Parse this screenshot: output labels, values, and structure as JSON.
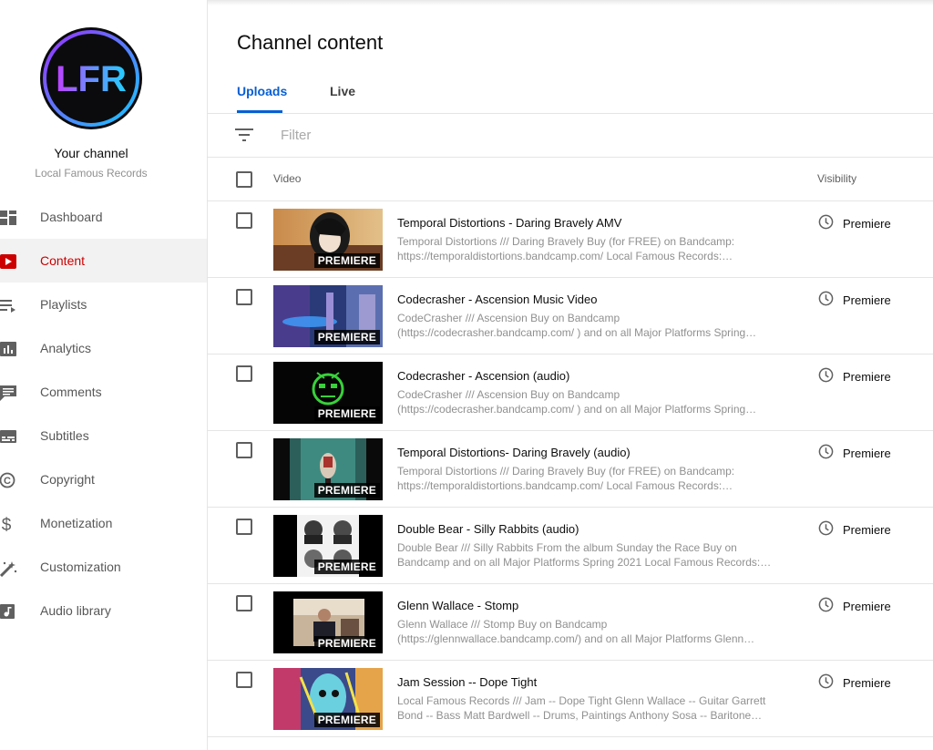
{
  "channel": {
    "logo_text": "LFR",
    "title": "Your channel",
    "name": "Local Famous Records"
  },
  "nav": {
    "items": [
      {
        "label": "Dashboard",
        "icon": "dashboard-icon",
        "active": false
      },
      {
        "label": "Content",
        "icon": "content-icon",
        "active": true
      },
      {
        "label": "Playlists",
        "icon": "playlists-icon",
        "active": false
      },
      {
        "label": "Analytics",
        "icon": "analytics-icon",
        "active": false
      },
      {
        "label": "Comments",
        "icon": "comments-icon",
        "active": false
      },
      {
        "label": "Subtitles",
        "icon": "subtitles-icon",
        "active": false
      },
      {
        "label": "Copyright",
        "icon": "copyright-icon",
        "active": false
      },
      {
        "label": "Monetization",
        "icon": "monetization-icon",
        "active": false
      },
      {
        "label": "Customization",
        "icon": "customization-icon",
        "active": false
      },
      {
        "label": "Audio library",
        "icon": "audio-library-icon",
        "active": false
      }
    ]
  },
  "main": {
    "title": "Channel content",
    "tabs": [
      {
        "label": "Uploads",
        "active": true
      },
      {
        "label": "Live",
        "active": false
      }
    ],
    "filter": {
      "placeholder": "Filter",
      "value": ""
    },
    "columns": {
      "video": "Video",
      "visibility": "Visibility"
    }
  },
  "videos": [
    {
      "title": "Temporal Distortions - Daring Bravely AMV",
      "desc_line1": "Temporal Distortions /// Daring Bravely Buy (for FREE) on Bandcamp:",
      "desc_line2": "https://temporaldistortions.bandcamp.com/ Local Famous Records:…",
      "badge": "PREMIERE",
      "visibility": "Premiere"
    },
    {
      "title": "Codecrasher - Ascension Music Video",
      "desc_line1": "CodeCrasher /// Ascension Buy on Bandcamp",
      "desc_line2": "(https://codecrasher.bandcamp.com/ ) and on all Major Platforms Spring…",
      "badge": "PREMIERE",
      "visibility": "Premiere"
    },
    {
      "title": "Codecrasher - Ascension (audio)",
      "desc_line1": "CodeCrasher /// Ascension Buy on Bandcamp",
      "desc_line2": "(https://codecrasher.bandcamp.com/ ) and on all Major Platforms Spring…",
      "badge": "PREMIERE",
      "visibility": "Premiere"
    },
    {
      "title": "Temporal Distortions- Daring Bravely (audio)",
      "desc_line1": "Temporal Distortions /// Daring Bravely Buy (for FREE) on Bandcamp:",
      "desc_line2": "https://temporaldistortions.bandcamp.com/ Local Famous Records:…",
      "badge": "PREMIERE",
      "visibility": "Premiere"
    },
    {
      "title": "Double Bear - Silly Rabbits (audio)",
      "desc_line1": "Double Bear /// Silly Rabbits From the album Sunday the Race Buy on",
      "desc_line2": "Bandcamp and on all Major Platforms Spring 2021 Local Famous Records:…",
      "badge": "PREMIERE",
      "visibility": "Premiere"
    },
    {
      "title": "Glenn Wallace - Stomp",
      "desc_line1": "Glenn Wallace /// Stomp Buy on Bandcamp",
      "desc_line2": "(https://glennwallace.bandcamp.com/) and on all Major Platforms Glenn…",
      "badge": "PREMIERE",
      "visibility": "Premiere"
    },
    {
      "title": "Jam Session -- Dope Tight",
      "desc_line1": "Local Famous Records /// Jam -- Dope Tight Glenn Wallace -- Guitar Garrett",
      "desc_line2": "Bond -- Bass Matt Bardwell -- Drums, Paintings Anthony Sosa -- Baritone…",
      "badge": "PREMIERE",
      "visibility": "Premiere"
    }
  ],
  "colors": {
    "accent_blue": "#065fd4",
    "active_red": "#cc0000",
    "logo_gradient_start": "#8a2be2",
    "logo_gradient_end": "#1ec8ff"
  }
}
